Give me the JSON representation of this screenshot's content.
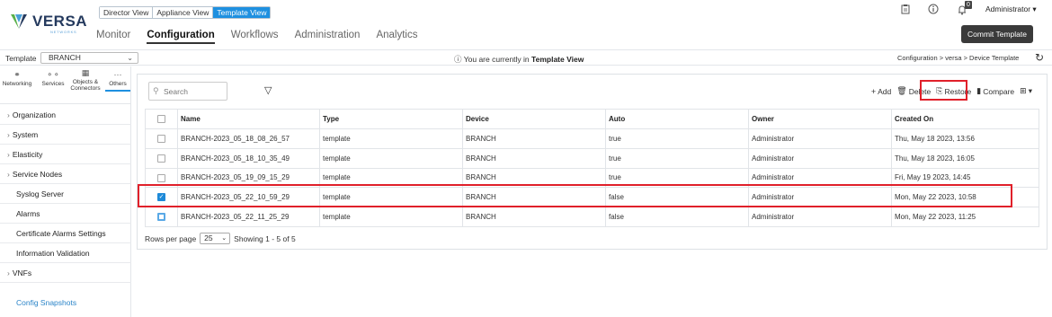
{
  "app": {
    "brand": "VERSA",
    "brand_sub": "NETWORKS",
    "view_toggle": [
      "Director View",
      "Appliance View",
      "Template View"
    ],
    "active_view": "Template View",
    "nav": [
      "Monitor",
      "Configuration",
      "Workflows",
      "Administration",
      "Analytics"
    ],
    "active_nav": "Configuration",
    "notification_count": "0",
    "user_label": "Administrator ▾",
    "commit_label": "Commit Template"
  },
  "template_bar": {
    "label": "Template",
    "selected": "BRANCH",
    "notice_prefix": "You are currently in",
    "notice_bold": "Template View",
    "breadcrumb": "Configuration  >  versa  >  Device Template"
  },
  "sidebar": {
    "tabs": [
      {
        "label": "Networking",
        "icon": "network-icon"
      },
      {
        "label": "Services",
        "icon": "services-icon"
      },
      {
        "label": "Objects & Connectors",
        "icon": "objects-icon"
      },
      {
        "label": "Others",
        "icon": "more-icon"
      }
    ],
    "active_tab": "Others",
    "items": [
      {
        "label": "Organization",
        "expandable": true
      },
      {
        "label": "System",
        "expandable": true
      },
      {
        "label": "Elasticity",
        "expandable": true
      },
      {
        "label": "Service Nodes",
        "expandable": true
      },
      {
        "label": "Syslog Server",
        "expandable": false
      },
      {
        "label": "Alarms",
        "expandable": false
      },
      {
        "label": "Certificate Alarms Settings",
        "expandable": false
      },
      {
        "label": "Information Validation",
        "expandable": false
      },
      {
        "label": "VNFs",
        "expandable": true
      }
    ],
    "link": "Config Snapshots"
  },
  "content": {
    "search_placeholder": "Search",
    "toolbar": {
      "add": "Add",
      "delete": "Delete",
      "restore": "Restore",
      "compare": "Compare"
    },
    "columns": [
      "Name",
      "Type",
      "Device",
      "Auto",
      "Owner",
      "Created On"
    ],
    "rows": [
      {
        "name": "BRANCH-2023_05_18_08_26_57",
        "type": "template",
        "device": "BRANCH",
        "auto": "true",
        "owner": "Administrator",
        "created": "Thu, May 18 2023, 13:56",
        "checked": false
      },
      {
        "name": "BRANCH-2023_05_18_10_35_49",
        "type": "template",
        "device": "BRANCH",
        "auto": "true",
        "owner": "Administrator",
        "created": "Thu, May 18 2023, 16:05",
        "checked": false
      },
      {
        "name": "BRANCH-2023_05_19_09_15_29",
        "type": "template",
        "device": "BRANCH",
        "auto": "true",
        "owner": "Administrator",
        "created": "Fri, May 19 2023, 14:45",
        "checked": false
      },
      {
        "name": "BRANCH-2023_05_22_10_59_29",
        "type": "template",
        "device": "BRANCH",
        "auto": "false",
        "owner": "Administrator",
        "created": "Mon, May 22 2023, 10:58",
        "checked": true
      },
      {
        "name": "BRANCH-2023_05_22_11_25_29",
        "type": "template",
        "device": "BRANCH",
        "auto": "false",
        "owner": "Administrator",
        "created": "Mon, May 22 2023, 11:25",
        "checked": false
      }
    ],
    "pager": {
      "rows_per_page_label": "Rows per page",
      "rows_per_page": "25",
      "showing": "Showing  1  -  5  of  5"
    }
  },
  "colors": {
    "accent": "#1e90e0",
    "highlight": "#e0202a",
    "commit_bg": "#3a3a3a"
  }
}
